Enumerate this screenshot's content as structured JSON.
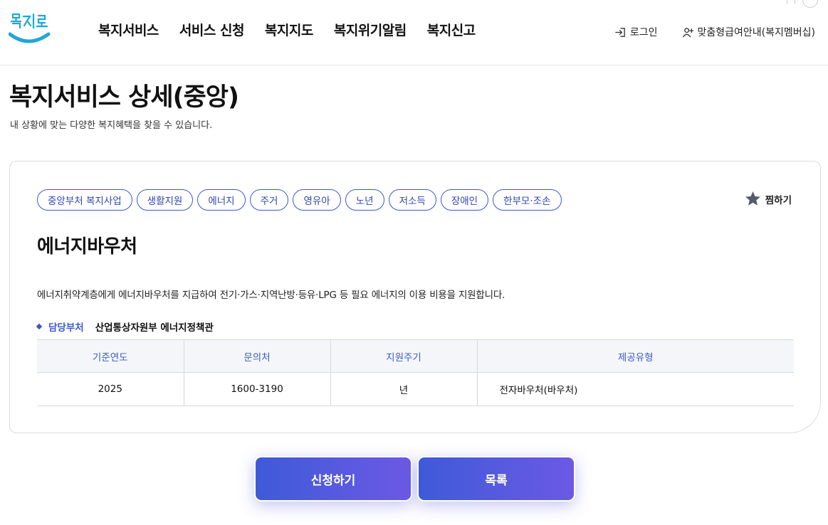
{
  "header": {
    "nav": [
      "복지서비스",
      "서비스 신청",
      "복지지도",
      "복지위기알림",
      "복지신고"
    ],
    "login_label": "로그인",
    "membership_label": "맞춤형급여안내(복지멤버십)"
  },
  "page": {
    "title": "복지서비스 상세(중앙)",
    "description": "내 상황에 맞는 다양한 복지혜택을 찾을 수 있습니다."
  },
  "service": {
    "tags": [
      "중앙부처 복지사업",
      "생활지원",
      "에너지",
      "주거",
      "영유아",
      "노년",
      "저소득",
      "장애인",
      "한부모·조손"
    ],
    "bookmark_label": "찜하기",
    "title": "에너지바우처",
    "description": "에너지취약계층에게 에너지바우처를 지급하여 전기·가스·지역난방·등유·LPG 등 필요 에너지의 이용 비용을 지원합니다.",
    "dept_label": "담당부처",
    "dept_value": "산업통상자원부 에너지정책관",
    "table": {
      "headers": [
        "기준연도",
        "문의처",
        "지원주기",
        "제공유형"
      ],
      "row": [
        "2025",
        "1600-3190",
        "년",
        "전자바우처(바우처)"
      ]
    }
  },
  "actions": {
    "apply_label": "신청하기",
    "list_label": "목록"
  },
  "colors": {
    "accent": "#3d59c8",
    "button_start": "#3e5ad8",
    "button_end": "#6c59e4"
  }
}
